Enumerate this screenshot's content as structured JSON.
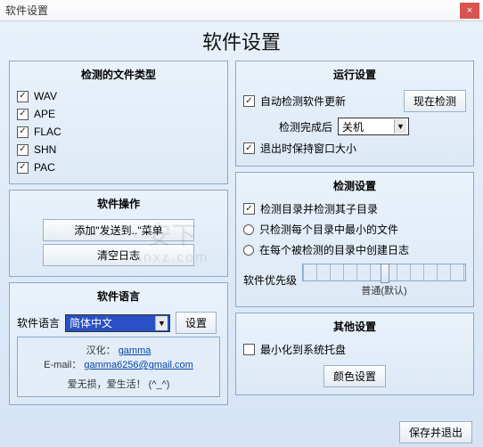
{
  "window": {
    "title": "软件设置",
    "close": "×"
  },
  "page_title": "软件设置",
  "groups": {
    "file_types": {
      "title": "检测的文件类型",
      "items": [
        {
          "label": "WAV",
          "checked": true
        },
        {
          "label": "APE",
          "checked": true
        },
        {
          "label": "FLAC",
          "checked": true
        },
        {
          "label": "SHN",
          "checked": true
        },
        {
          "label": "PAC",
          "checked": true
        }
      ]
    },
    "operations": {
      "title": "软件操作",
      "add_sendto": "添加\"发送到..\"菜单",
      "clear_log": "清空日志"
    },
    "language": {
      "title": "软件语言",
      "label": "软件语言",
      "selected": "简体中文",
      "set_btn": "设置",
      "credit_label": "汉化：",
      "credit_name": "gamma",
      "email_label": "E-mail：",
      "email": "gamma6256@gmail.com",
      "slogan": "爱无损，爱生活！ (^_^)"
    },
    "run": {
      "title": "运行设置",
      "auto_update": "自动检测软件更新",
      "check_now": "现在检测",
      "after_done_label": "检测完成后",
      "after_done_value": "关机",
      "keep_size": "退出时保持窗口大小"
    },
    "detect": {
      "title": "检测设置",
      "check_subdirs": {
        "label": "检测目录并检测其子目录",
        "checked": true
      },
      "only_min": {
        "label": "只检测每个目录中最小的文件",
        "checked": false
      },
      "create_log": {
        "label": "在每个被检测的目录中创建日志",
        "checked": false
      },
      "priority_label": "软件优先级",
      "priority_caption": "普通(默认)"
    },
    "other": {
      "title": "其他设置",
      "tray": "最小化到系统托盘",
      "color_btn": "颜色设置"
    }
  },
  "footer": {
    "save_exit": "保存并退出"
  },
  "watermark": {
    "main": "安下",
    "sub": "anxz.com"
  }
}
